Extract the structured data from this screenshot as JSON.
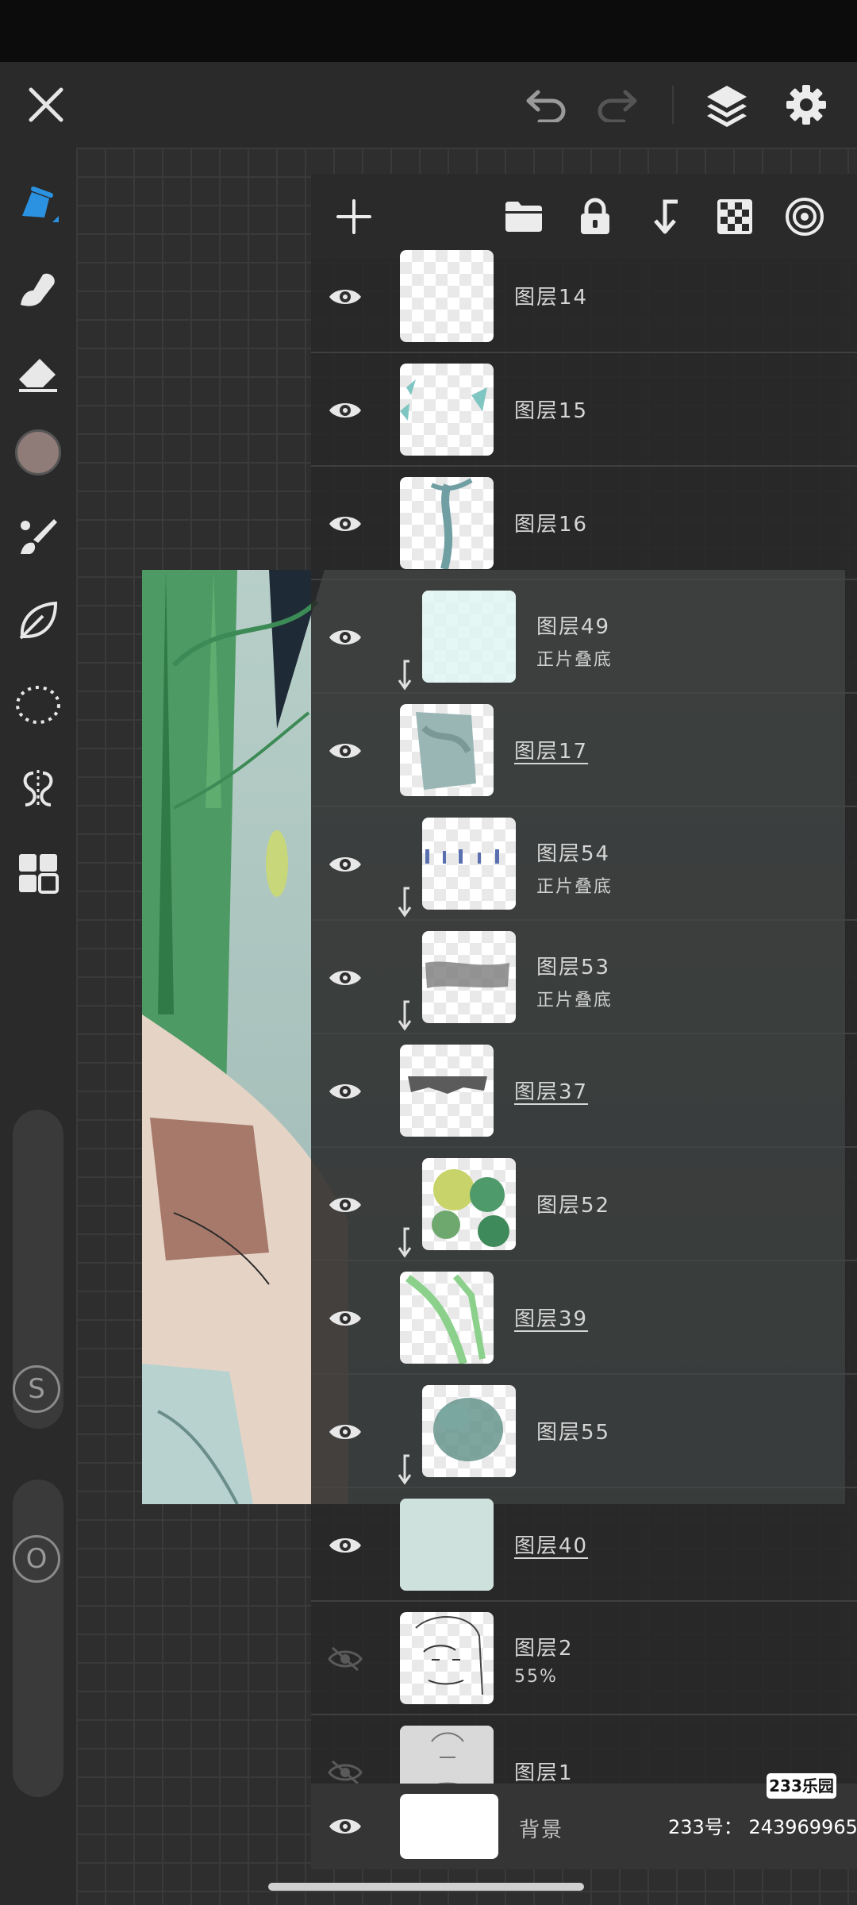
{
  "status_bar": {},
  "toolbar": {
    "close_icon": "close-icon",
    "undo_icon": "undo-icon",
    "redo_icon": "redo-icon",
    "layers_icon": "layers-icon",
    "settings_icon": "gear-icon"
  },
  "left_tools": [
    "brush-tool-icon",
    "smudge-tool-icon",
    "eraser-icon",
    "color-swatch",
    "brush-library-icon",
    "fill-tool-icon",
    "selection-lasso-icon",
    "symmetry-icon",
    "grid-menu-icon"
  ],
  "colors": {
    "current_color": "#8f7c78",
    "active_tool": "#3aa0e8",
    "panel_bg": "#2a2a2a"
  },
  "size_slider_label": "S",
  "opacity_slider_label": "O",
  "layers_toolbar": [
    "add-layer-icon",
    "folder-icon",
    "lock-icon",
    "clip-merge-icon",
    "transparency-lock-icon",
    "blend-mode-icon"
  ],
  "layers": [
    {
      "name": "图层14",
      "visible": true,
      "clipped": false,
      "underlined": false
    },
    {
      "name": "图层15",
      "visible": true,
      "clipped": false,
      "underlined": false
    },
    {
      "name": "图层16",
      "visible": true,
      "clipped": false,
      "underlined": false
    },
    {
      "name": "图层49",
      "sub": "正片叠底",
      "visible": true,
      "clipped": true,
      "underlined": false
    },
    {
      "name": "图层17",
      "visible": true,
      "clipped": false,
      "underlined": true
    },
    {
      "name": "图层54",
      "sub": "正片叠底",
      "visible": true,
      "clipped": true,
      "underlined": false
    },
    {
      "name": "图层53",
      "sub": "正片叠底",
      "visible": true,
      "clipped": true,
      "underlined": false
    },
    {
      "name": "图层37",
      "visible": true,
      "clipped": false,
      "underlined": true
    },
    {
      "name": "图层52",
      "visible": true,
      "clipped": true,
      "underlined": false
    },
    {
      "name": "图层39",
      "visible": true,
      "clipped": false,
      "underlined": true
    },
    {
      "name": "图层55",
      "visible": true,
      "clipped": true,
      "underlined": false
    },
    {
      "name": "图层40",
      "visible": true,
      "clipped": false,
      "underlined": true
    },
    {
      "name": "图层2",
      "sub": "55%",
      "visible": false,
      "clipped": false,
      "underlined": false
    },
    {
      "name": "图层1",
      "visible": false,
      "clipped": false,
      "underlined": false
    }
  ],
  "background_layer": {
    "name": "背景",
    "visible": true
  },
  "watermark": {
    "logo": "233乐园",
    "id_text": "233号： 243969965"
  }
}
